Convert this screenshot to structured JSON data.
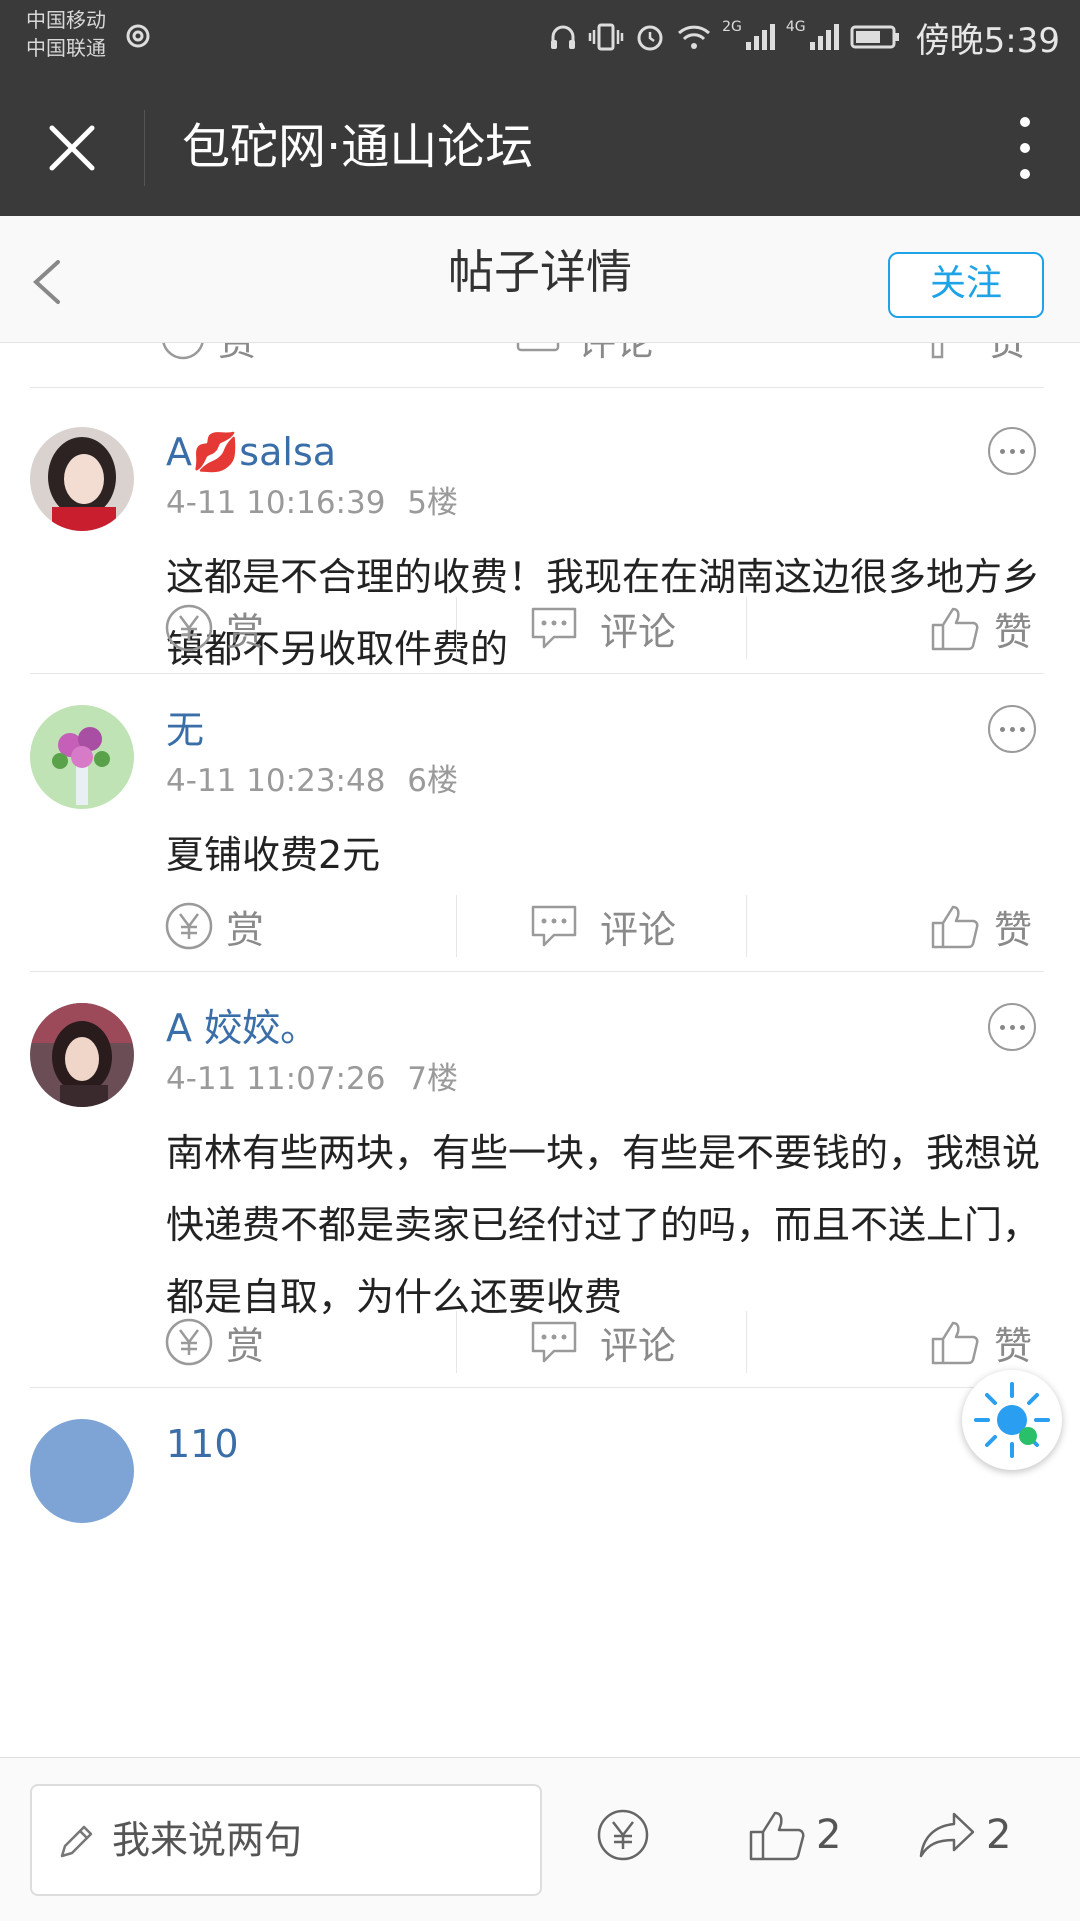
{
  "status_bar": {
    "carrier_1": "中国移动",
    "carrier_2": "中国联通",
    "network_1": "2G",
    "network_2": "4G",
    "time": "傍晚5:39"
  },
  "title_bar": {
    "title": "包砣网·通山论坛"
  },
  "header": {
    "title": "帖子详情",
    "follow_label": "关注"
  },
  "action_labels": {
    "reward": "赏",
    "comment": "评论",
    "like": "赞"
  },
  "posts": [
    {
      "username": "A💋salsa",
      "timestamp": "4-11 10:16:39",
      "floor": "5楼",
      "content": "这都是不合理的收费！我现在在湖南这边很多地方乡镇都不另收取件费的"
    },
    {
      "username": "无",
      "timestamp": "4-11 10:23:48",
      "floor": "6楼",
      "content": "夏铺收费2元"
    },
    {
      "username": "A 姣姣。",
      "timestamp": "4-11 11:07:26",
      "floor": "7楼",
      "content": "南林有些两块，有些一块，有些是不要钱的，我想说快递费不都是卖家已经付过了的吗，而且不送上门，都是自取，为什么还要收费"
    },
    {
      "username": "110"
    }
  ],
  "bottom_bar": {
    "input_placeholder": "我来说两句",
    "like_count": "2",
    "share_count": "2"
  },
  "icons": {
    "accent": "#1fa3e8",
    "username_color": "#3a6ea8"
  }
}
